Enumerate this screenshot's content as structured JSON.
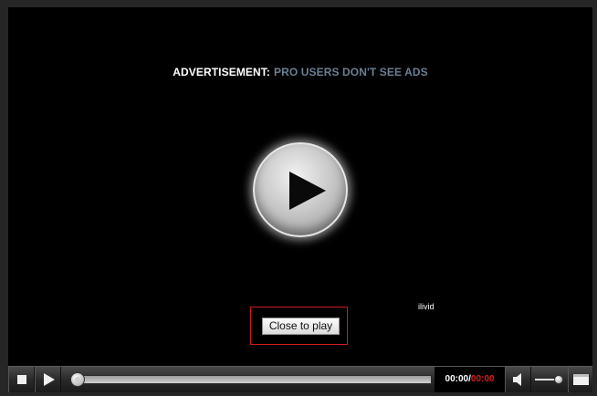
{
  "ad": {
    "label": "ADVERTISEMENT:",
    "pro_text": "PRO USERS DON'T SEE ADS"
  },
  "overlay": {
    "close_label": "Close to play",
    "brand": "ilivid"
  },
  "controls": {
    "current_time": "00:00",
    "separator": "/",
    "duration": "00:00",
    "seek_progress": 0,
    "volume_level": 0.85
  },
  "colors": {
    "ad_pro_text": "#6b7f93",
    "duration_text": "#d61f1f",
    "close_highlight": "#d31b1b"
  }
}
